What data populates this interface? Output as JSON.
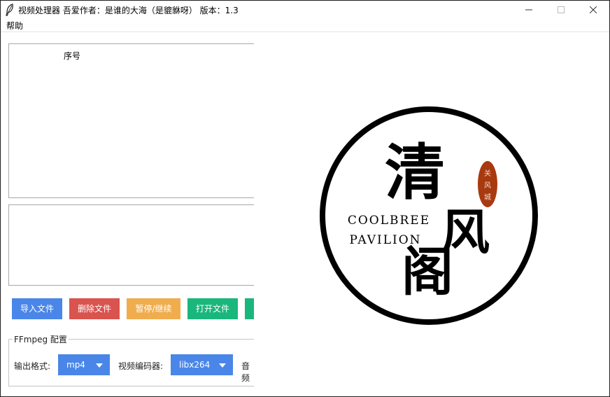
{
  "window": {
    "title": "视频处理器   吾爱作者：是谁的大海（是貔貅呀）  版本：1.3",
    "controls": [
      "minimize",
      "maximize",
      "close"
    ]
  },
  "menubar": {
    "items": [
      {
        "label": "帮助"
      }
    ]
  },
  "file_list": {
    "columns": [
      {
        "label": "序号"
      }
    ]
  },
  "log": {
    "text": ""
  },
  "buttons": {
    "import": "导入文件",
    "delete": "删除文件",
    "pause_resume": "暂停/继续",
    "open_file": "打开文件"
  },
  "ffmpeg": {
    "group_label": "FFmpeg 配置",
    "output_format_label": "输出格式:",
    "output_format_value": "mp4",
    "video_encoder_label": "视频编码器:",
    "video_encoder_value": "libx264",
    "audio_label_partial": "音频"
  },
  "logo": {
    "char1": "清",
    "char2": "风",
    "char3": "阁",
    "seal_chars": [
      "关",
      "风",
      "城"
    ],
    "english_line1": "COOLBREE",
    "english_line2": "PAVILION"
  },
  "colors": {
    "blue": "#4a86e8",
    "red": "#d9534f",
    "orange": "#f0ad4e",
    "green": "#1ab77c",
    "seal": "#a83a10"
  }
}
